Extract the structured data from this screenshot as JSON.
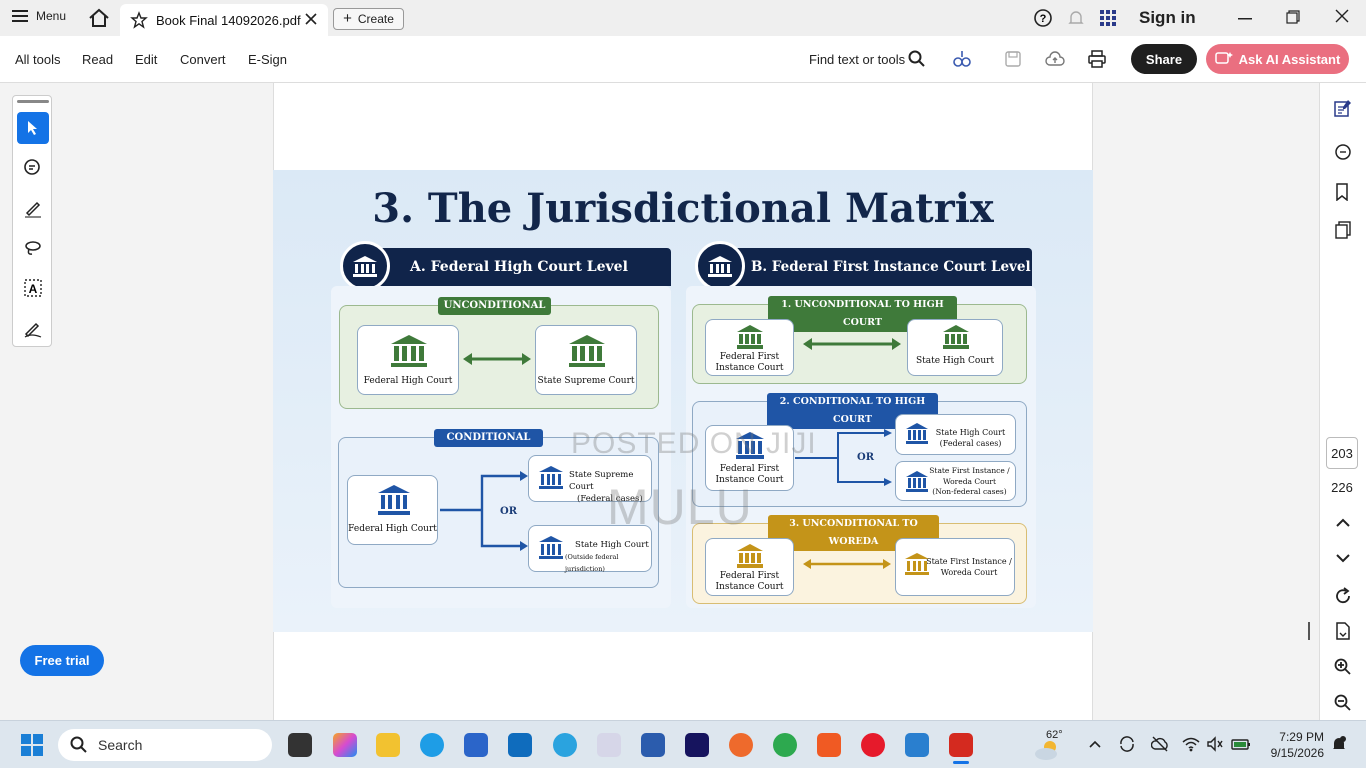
{
  "titlebar": {
    "menu_label": "Menu",
    "tab_title": "Book Final 14092026.pdf",
    "create_label": "Create",
    "signin_label": "Sign in"
  },
  "toolbar": {
    "items": [
      "All tools",
      "Read",
      "Edit",
      "Convert",
      "E-Sign"
    ],
    "find_label": "Find text or tools",
    "share_label": "Share",
    "ai_label": "Ask AI Assistant"
  },
  "viewer": {
    "current_page": "203",
    "total_pages": "226",
    "free_trial_label": "Free trial"
  },
  "slide": {
    "title": "3. The Jurisdictional Matrix",
    "watermark_1": "POSTED ON JIJI",
    "watermark_2": "MULU",
    "section_a": {
      "header": "A. Federal High Court Level",
      "unconditional_label": "UNCONDITIONAL",
      "unc_left": "Federal High Court",
      "unc_right": "State Supreme Court",
      "conditional_label": "CONDITIONAL",
      "cond_source": "Federal High Court",
      "cond_or": "OR",
      "cond_top_1": "State Supreme Court",
      "cond_top_2": "(Federal cases)",
      "cond_bottom_1": "State High Court",
      "cond_bottom_2": "(Outside federal jurisdiction)"
    },
    "section_b": {
      "header": "B. Federal First Instance Court Level",
      "g1_label": "1. UNCONDITIONAL TO HIGH COURT",
      "g1_left_1": "Federal First",
      "g1_left_2": "Instance Court",
      "g1_right": "State High Court",
      "g2_label": "2. CONDITIONAL TO HIGH COURT",
      "g2_left_1": "Federal First",
      "g2_left_2": "Instance Court",
      "g2_or": "OR",
      "g2_top_1": "State High Court",
      "g2_top_2": "(Federal cases)",
      "g2_bot_1": "State First Instance /",
      "g2_bot_2": "Woreda Court",
      "g2_bot_3": "(Non-federal cases)",
      "g3_label": "3. UNCONDITIONAL TO WOREDA",
      "g3_left_1": "Federal First",
      "g3_left_2": "Instance Court",
      "g3_right_1": "State First Instance /",
      "g3_right_2": "Woreda Court"
    }
  },
  "taskbar": {
    "search_placeholder": "Search",
    "weather_temp": "62°",
    "time": "7:29 PM",
    "date": "9/15/2026"
  },
  "colors": {
    "navy": "#10244a",
    "green": "#3f7a3a",
    "blue": "#1f55a6",
    "gold": "#c49419",
    "share_bg": "#1f1f1f",
    "ai_bg": "#ea6f80",
    "free_trial_bg": "#1473e6"
  }
}
